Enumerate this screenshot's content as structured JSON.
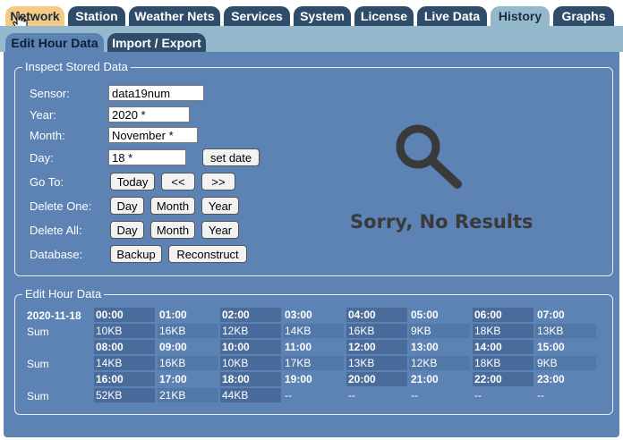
{
  "top_tabs": [
    {
      "label": "Network",
      "state": "hover"
    },
    {
      "label": "Station",
      "state": "normal"
    },
    {
      "label": "Weather Nets",
      "state": "normal"
    },
    {
      "label": "Services",
      "state": "normal"
    },
    {
      "label": "System",
      "state": "normal"
    },
    {
      "label": "License",
      "state": "normal"
    },
    {
      "label": "Live Data",
      "state": "normal"
    },
    {
      "label": "History",
      "state": "active"
    },
    {
      "label": "Graphs",
      "state": "normal"
    }
  ],
  "sub_tabs": [
    {
      "label": "Edit Hour Data",
      "state": "active"
    },
    {
      "label": "Import / Export",
      "state": "inactive"
    }
  ],
  "inspect": {
    "legend": "Inspect Stored Data",
    "sensor_label": "Sensor:",
    "sensor_value": "data19num",
    "year_label": "Year:",
    "year_value": "2020 *",
    "month_label": "Month:",
    "month_value": "November *",
    "day_label": "Day:",
    "day_value": "18 *",
    "set_date": "set date",
    "goto_label": "Go To:",
    "goto_today": "Today",
    "goto_prev": "<<",
    "goto_next": ">>",
    "delete_one_label": "Delete One:",
    "delete_all_label": "Delete All:",
    "day_btn": "Day",
    "month_btn": "Month",
    "year_btn": "Year",
    "database_label": "Database:",
    "backup": "Backup",
    "reconstruct": "Reconstruct",
    "no_results": "Sorry, No Results"
  },
  "edit_hour": {
    "legend": "Edit Hour Data",
    "date": "2020-11-18",
    "sum_label": "Sum",
    "rows": [
      {
        "hours": [
          "00:00",
          "01:00",
          "02:00",
          "03:00",
          "04:00",
          "05:00",
          "06:00",
          "07:00"
        ],
        "sizes": [
          "10KB",
          "16KB",
          "12KB",
          "14KB",
          "16KB",
          "9KB",
          "18KB",
          "13KB"
        ]
      },
      {
        "hours": [
          "08:00",
          "09:00",
          "10:00",
          "11:00",
          "12:00",
          "13:00",
          "14:00",
          "15:00"
        ],
        "sizes": [
          "14KB",
          "16KB",
          "10KB",
          "17KB",
          "13KB",
          "12KB",
          "18KB",
          "9KB"
        ]
      },
      {
        "hours": [
          "16:00",
          "17:00",
          "18:00",
          "19:00",
          "20:00",
          "21:00",
          "22:00",
          "23:00"
        ],
        "sizes": [
          "52KB",
          "21KB",
          "44KB",
          "--",
          "--",
          "--",
          "--",
          "--"
        ]
      }
    ]
  },
  "colors": {
    "tab_bg": "#2f4d6b",
    "active_tab": "#94b9cd",
    "hover_tab": "#f3cb84",
    "panel": "#5d82b4"
  }
}
